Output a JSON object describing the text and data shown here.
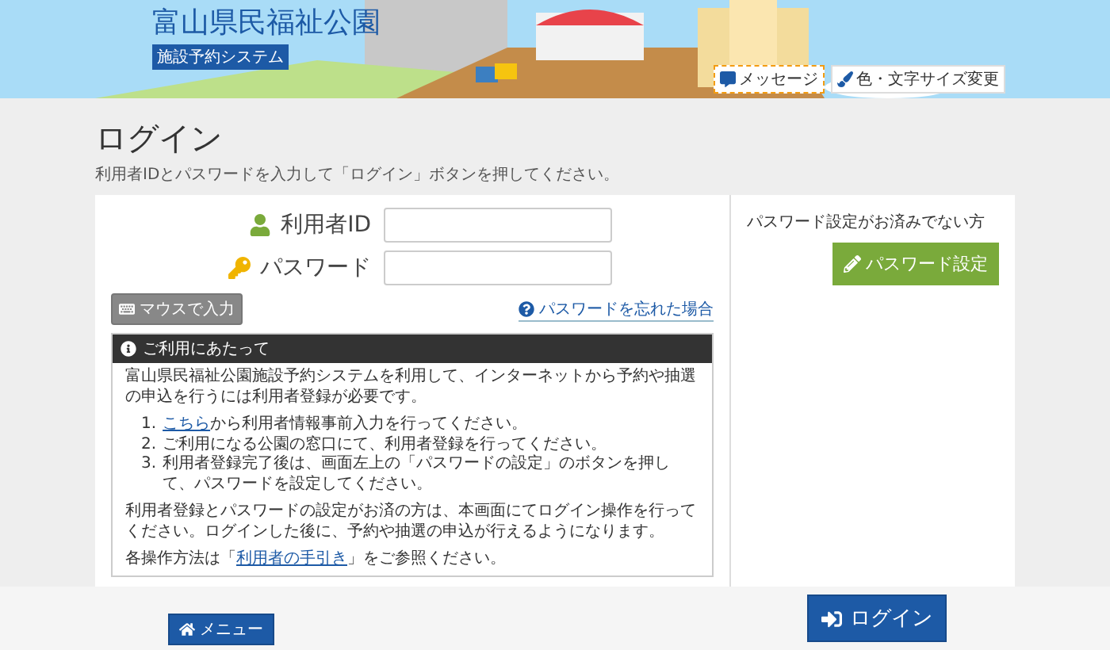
{
  "header": {
    "site_title": "富山県民福祉公園",
    "subtitle": "施設予約システム",
    "buttons": [
      {
        "kind": "message",
        "label": "メッセージ",
        "selected": true
      },
      {
        "kind": "brush",
        "label": "色・文字サイズ変更",
        "selected": false
      }
    ]
  },
  "page": {
    "title": "ログイン",
    "description": "利用者IDとパスワードを入力して「ログイン」ボタンを押してください。"
  },
  "login_form": {
    "fields": [
      {
        "kind": "user",
        "label": "利用者ID"
      },
      {
        "kind": "key",
        "label": "パスワード"
      }
    ],
    "mouse_input_button": "マウスで入力",
    "forgot_link": "パスワードを忘れた場合"
  },
  "notice": {
    "title": "ご利用にあたって",
    "intro": "富山県民福祉公園施設予約システムを利用して、インターネットから予約や抽選の申込を行うには利用者登録が必要です。",
    "steps": [
      {
        "number": "1.",
        "link": "こちら",
        "text": "から利用者情報事前入力を行ってください。"
      },
      {
        "number": "2.",
        "text": "ご利用になる公園の窓口にて、利用者登録を行ってください。"
      },
      {
        "number": "3.",
        "text": "利用者登録完了後は、画面左上の「パスワードの設定」のボタンを押して、パスワードを設定してください。"
      }
    ],
    "after": "利用者登録とパスワードの設定がお済の方は、本画面にてログイン操作を行ってください。ログインした後に、予約や抽選の申込が行えるようになります。",
    "guide_prefix": "各操作方法は「",
    "guide_link": "利用者の手引き",
    "guide_suffix": "」をご参照ください。"
  },
  "password_setup": {
    "prompt": "パスワード設定がお済みでない方",
    "button": "パスワード設定"
  },
  "footer": {
    "menu_button": "メニュー",
    "login_button": "ログイン"
  }
}
